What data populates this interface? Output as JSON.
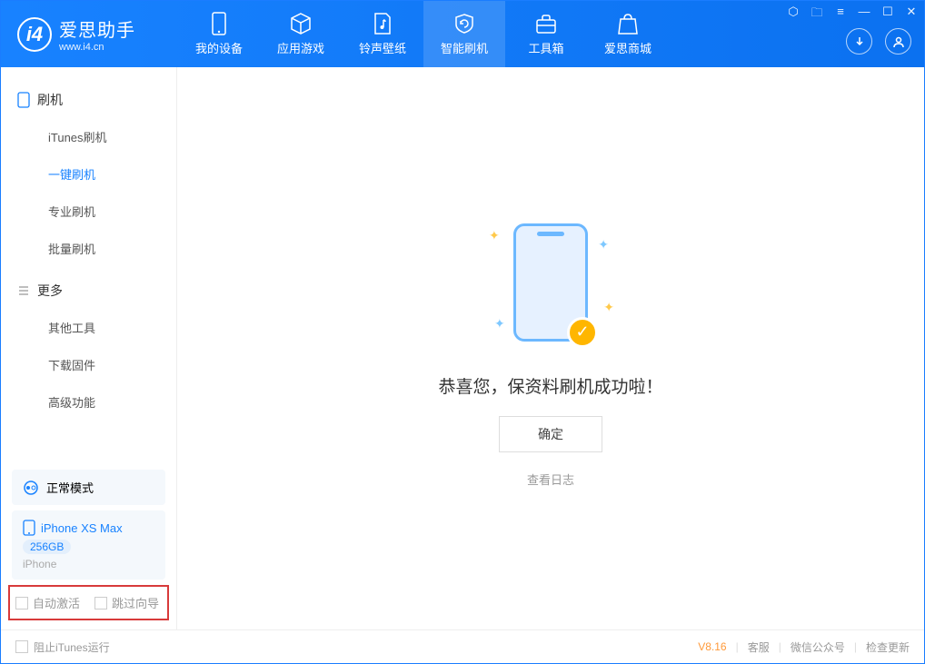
{
  "app": {
    "title": "爱思助手",
    "subtitle": "www.i4.cn"
  },
  "nav": {
    "items": [
      {
        "label": "我的设备"
      },
      {
        "label": "应用游戏"
      },
      {
        "label": "铃声壁纸"
      },
      {
        "label": "智能刷机"
      },
      {
        "label": "工具箱"
      },
      {
        "label": "爱思商城"
      }
    ]
  },
  "sidebar": {
    "group1": {
      "title": "刷机",
      "items": [
        {
          "label": "iTunes刷机"
        },
        {
          "label": "一键刷机"
        },
        {
          "label": "专业刷机"
        },
        {
          "label": "批量刷机"
        }
      ]
    },
    "group2": {
      "title": "更多",
      "items": [
        {
          "label": "其他工具"
        },
        {
          "label": "下载固件"
        },
        {
          "label": "高级功能"
        }
      ]
    },
    "mode": "正常模式",
    "device": {
      "name": "iPhone XS Max",
      "capacity": "256GB",
      "type": "iPhone"
    },
    "checks": {
      "auto_activate": "自动激活",
      "skip_guide": "跳过向导"
    }
  },
  "main": {
    "message": "恭喜您，保资料刷机成功啦！",
    "ok": "确定",
    "log": "查看日志"
  },
  "footer": {
    "block_itunes": "阻止iTunes运行",
    "version": "V8.16",
    "links": {
      "service": "客服",
      "wechat": "微信公众号",
      "update": "检查更新"
    }
  }
}
